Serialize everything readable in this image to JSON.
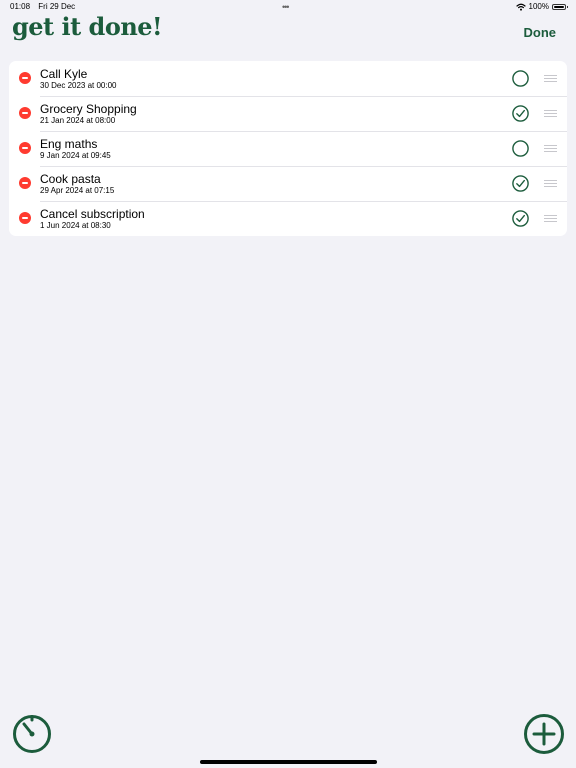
{
  "status_bar": {
    "time": "01:08",
    "date": "Fri 29 Dec",
    "multitask_dots": "•••",
    "battery": "100%",
    "battery_level": 1.0
  },
  "header": {
    "title": "get it done!",
    "done_label": "Done"
  },
  "colors": {
    "accent": "#1c5c3c",
    "delete": "#ff3b30",
    "background": "#f2f2f7"
  },
  "tasks": [
    {
      "title": "Call Kyle",
      "date": "30 Dec 2023 at 00:00",
      "completed": false
    },
    {
      "title": "Grocery Shopping",
      "date": "21 Jan 2024 at 08:00",
      "completed": true
    },
    {
      "title": "Eng maths",
      "date": "9 Jan 2024 at 09:45",
      "completed": false
    },
    {
      "title": "Cook pasta",
      "date": "29 Apr 2024 at 07:15",
      "completed": true
    },
    {
      "title": "Cancel subscription",
      "date": "1 Jun 2024 at 08:30",
      "completed": true
    }
  ],
  "toolbar": {
    "timer_icon": "timer-icon",
    "add_icon": "plus-circle-icon"
  }
}
